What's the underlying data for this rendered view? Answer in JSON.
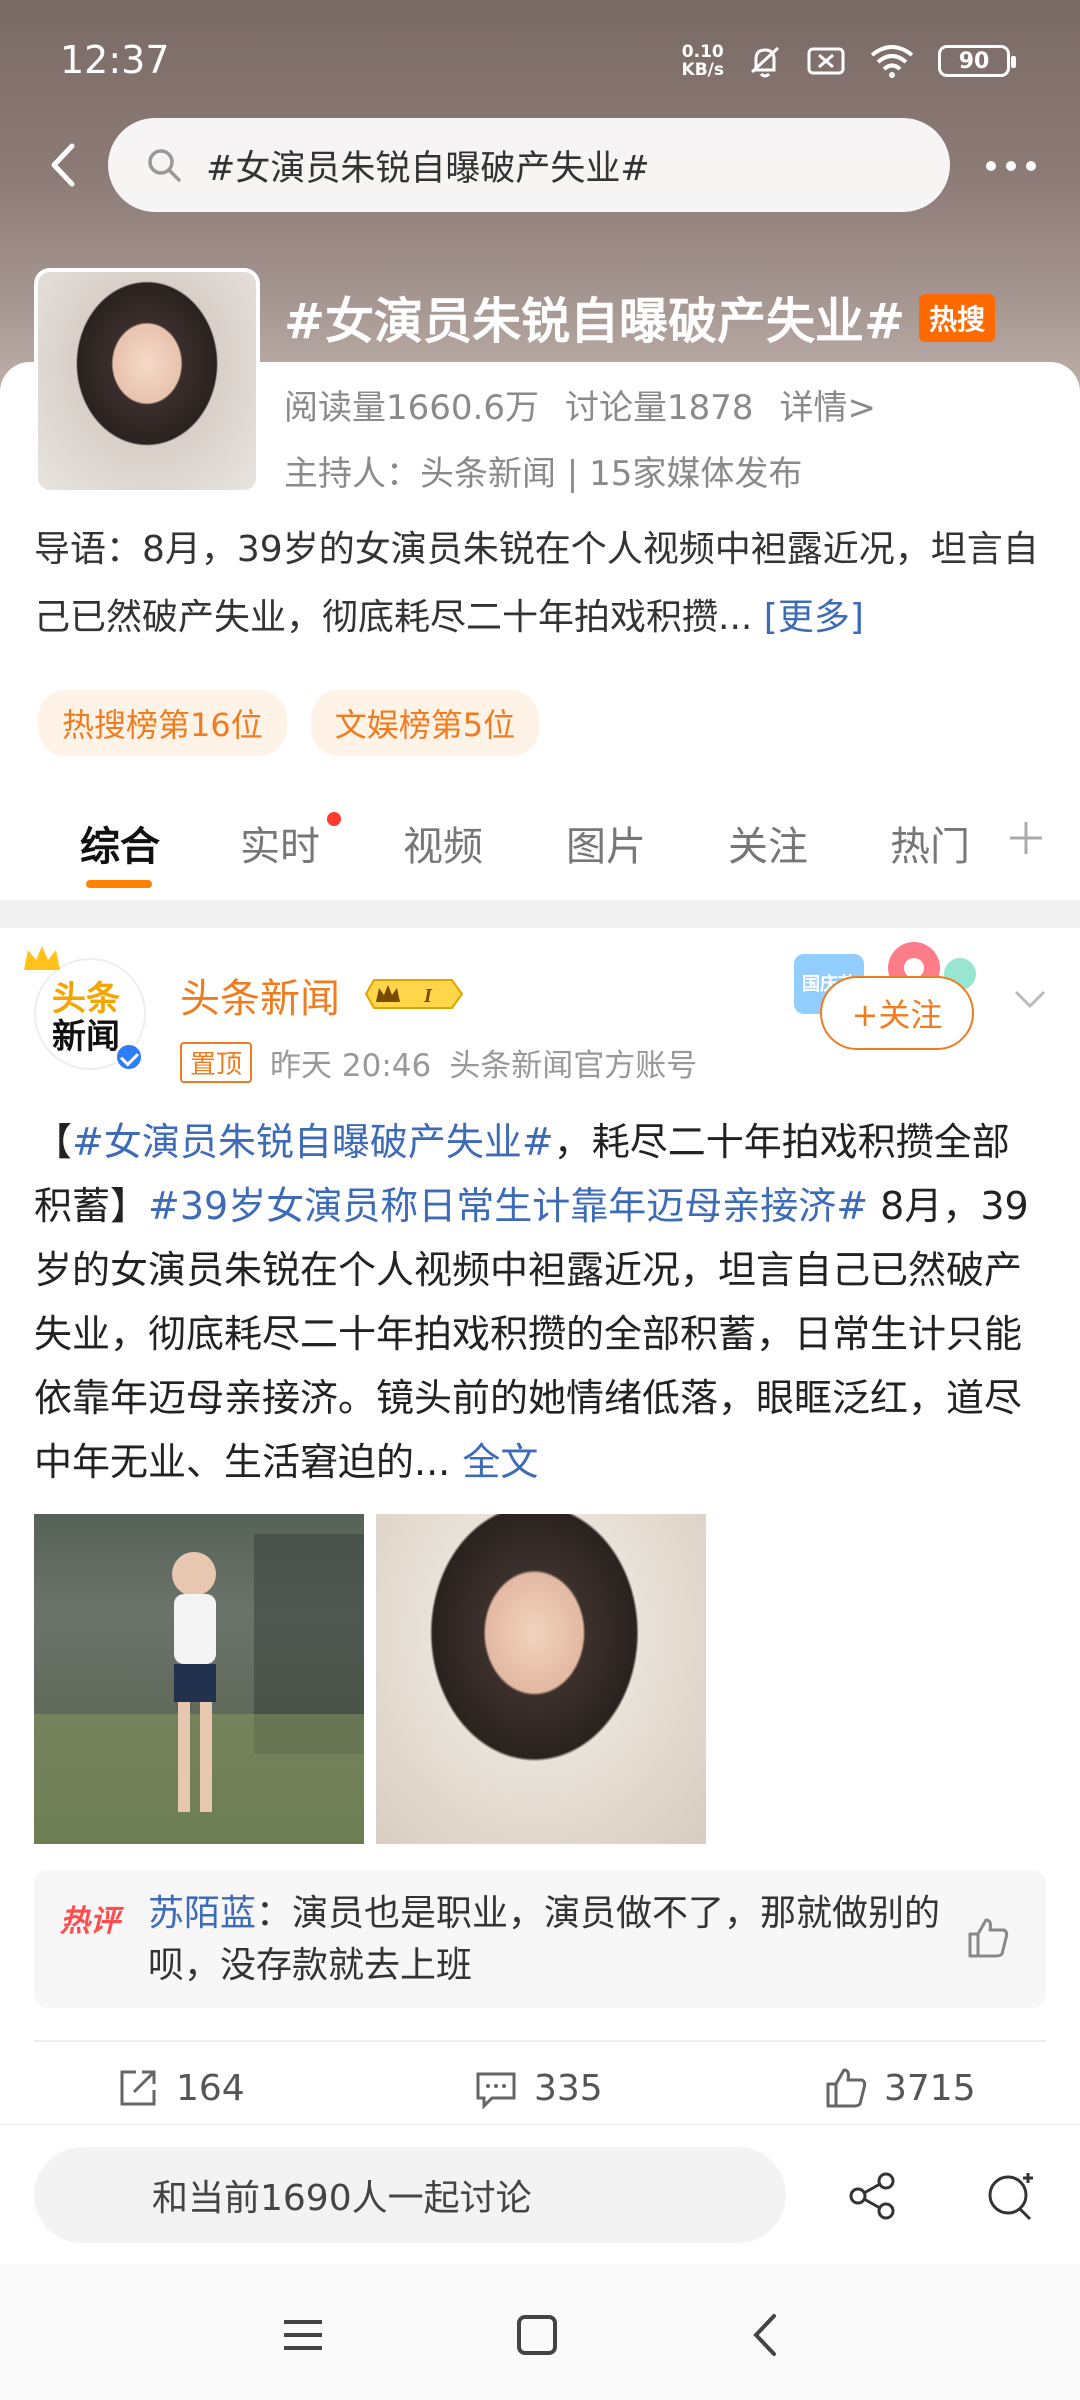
{
  "status": {
    "time": "12:37",
    "speed_value": "0.10",
    "speed_unit": "KB/s",
    "battery": "90"
  },
  "search": {
    "query": "#女演员朱锐自曝破产失业#"
  },
  "topic": {
    "title": "#女演员朱锐自曝破产失业#",
    "hot_badge": "热搜",
    "reads": "阅读量1660.6万",
    "discussions": "讨论量1878",
    "details": "详情>",
    "host": "主持人：头条新闻 | 15家媒体发布",
    "guide": "导语：8月，39岁的女演员朱锐在个人视频中袒露近况，坦言自己已然破产失业，彻底耗尽二十年拍戏积攒... ",
    "guide_more": "[更多]",
    "ranks": [
      "热搜榜第16位",
      "文娱榜第5位"
    ]
  },
  "tabs": [
    "综合",
    "实时",
    "视频",
    "图片",
    "关注",
    "热门"
  ],
  "post": {
    "avatar_text_1": "头条",
    "avatar_text_2": "新闻",
    "author": "头条新闻",
    "vip_level": "I",
    "pinned": "置顶",
    "time": "昨天 20:46",
    "source": "头条新闻官方账号",
    "follow": "+关注",
    "holiday_text": "国庆节",
    "body_link_1": "#女演员朱锐自曝破产失业#",
    "body_text_1": "，耗尽二十年拍戏积攒全部积蓄】",
    "body_link_2": "#39岁女演员称日常生计靠年迈母亲接济#",
    "body_text_2": " 8月，39岁的女演员朱锐在个人视频中袒露近况，坦言自己已然破产失业，彻底耗尽二十年拍戏积攒的全部积蓄，日常生计只能依靠年迈母亲接济。镜头前的她情绪低落，眼眶泛红，道尽中年无业、生活窘迫的... ",
    "full_text": "全文",
    "hot_comment_badge": "热评",
    "hot_comment_user": "苏陌蓝",
    "hot_comment_text": "：演员也是职业，演员做不了，那就做别的呗，没存款就去上班",
    "reposts": "164",
    "comments": "335",
    "likes": "3715"
  },
  "bottom": {
    "discuss_placeholder": "和当前1690人一起讨论"
  }
}
